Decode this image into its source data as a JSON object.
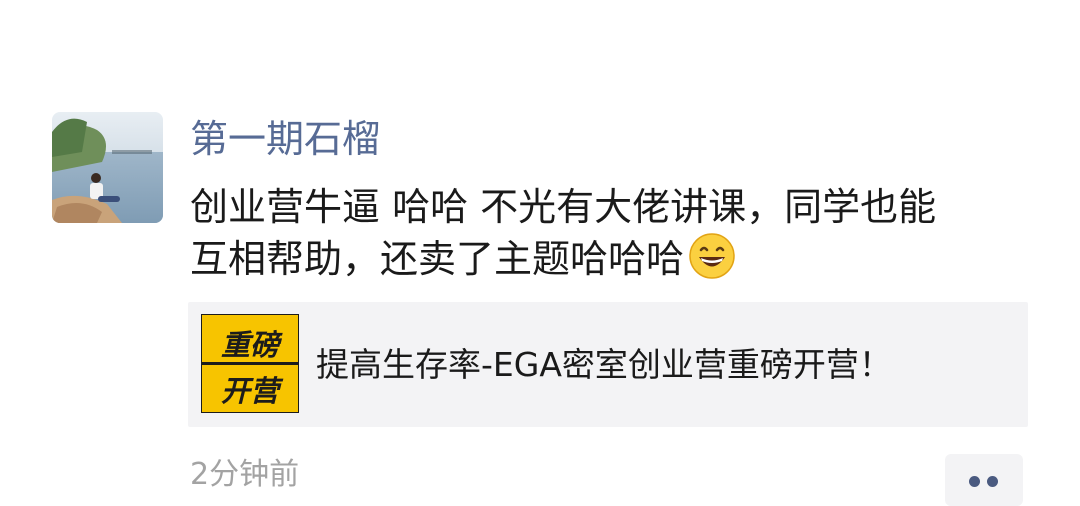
{
  "post": {
    "author": "第一期石榴",
    "content_line1": "创业营牛逼 哈哈 不光有大佬讲课，同学也能",
    "content_line2": "互相帮助，还卖了主题哈哈哈",
    "emoji": "grinning-face-emoji",
    "link": {
      "thumb_line1": "重磅",
      "thumb_line2": "开营",
      "title": "提高生存率-EGA密室创业营重磅开营！"
    },
    "time": "2分钟前"
  },
  "colors": {
    "author_name": "#576b95",
    "link_bg": "#f3f3f5",
    "thumb_bg": "#f7c400",
    "time": "#a3a3a3"
  }
}
